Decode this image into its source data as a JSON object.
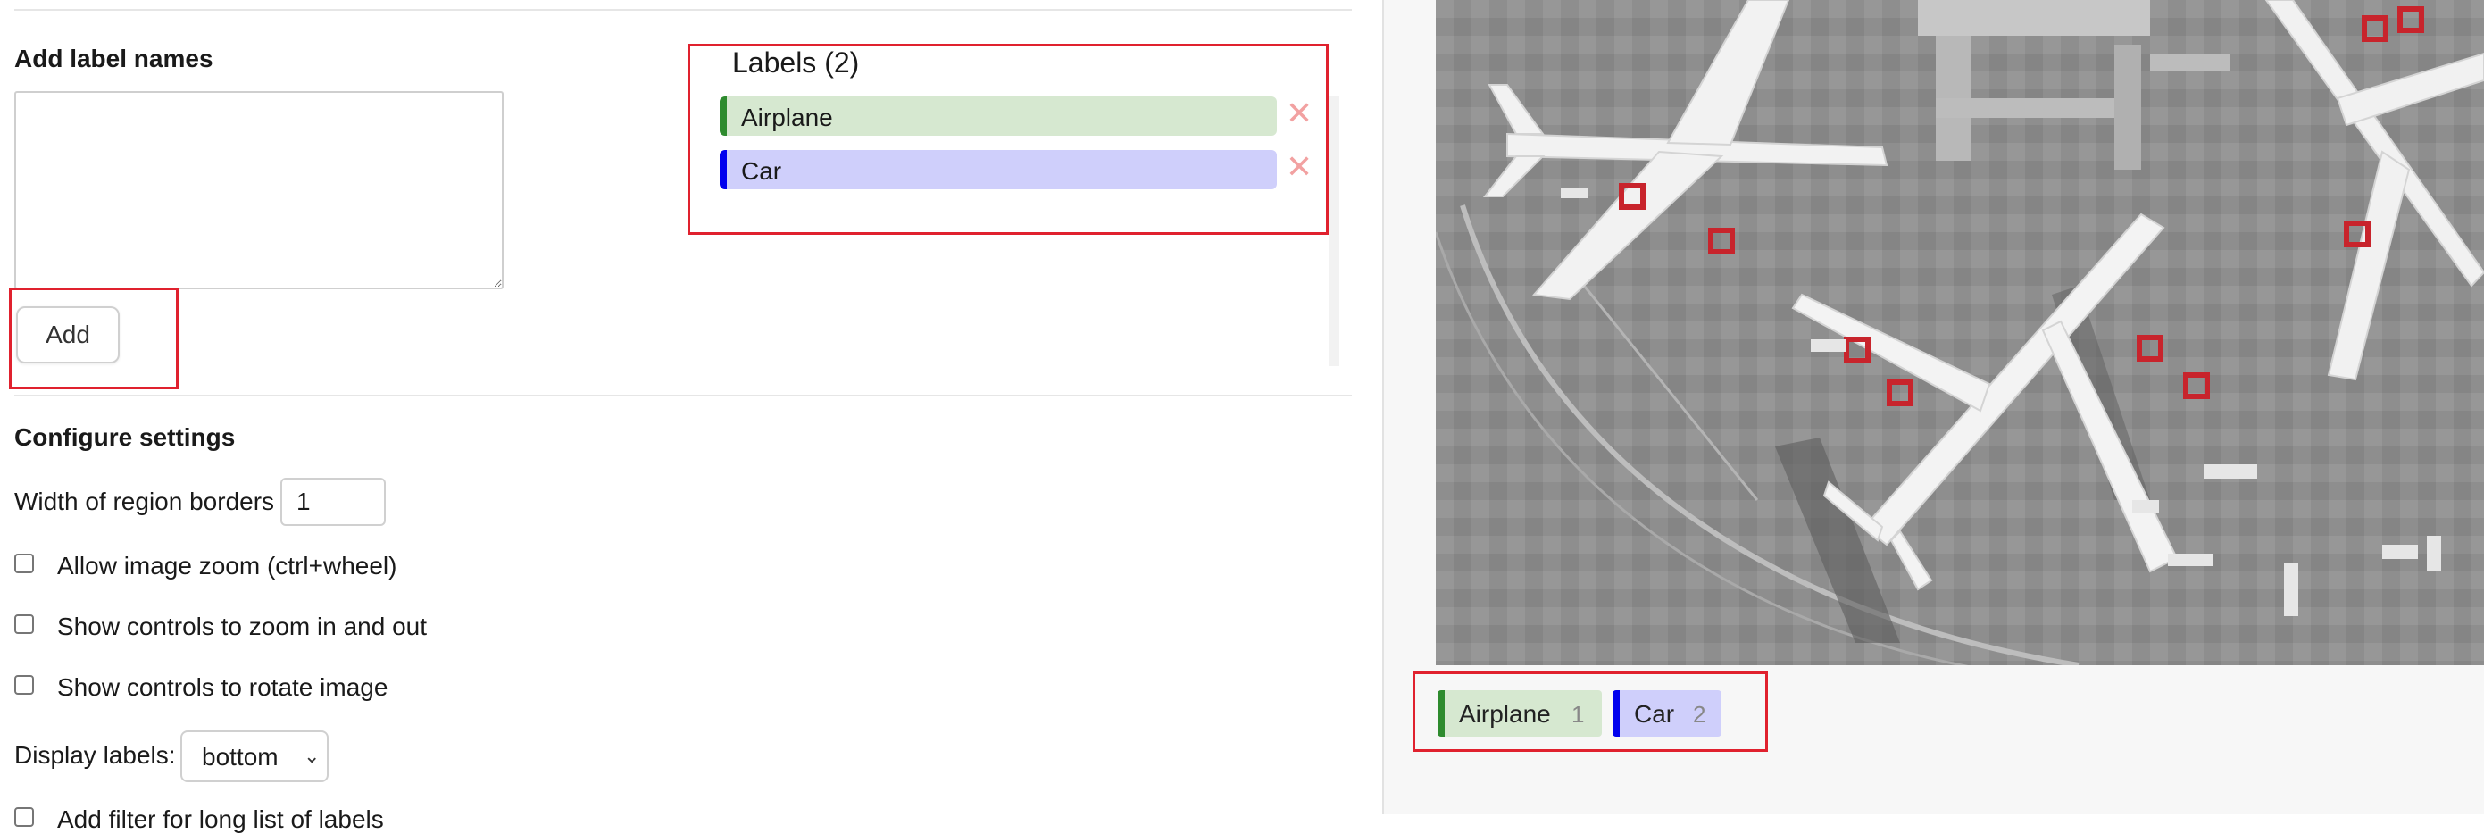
{
  "add_labels": {
    "title": "Add label names",
    "input_value": "",
    "add_button": "Add"
  },
  "labels_panel": {
    "title": "Labels (2)",
    "items": [
      {
        "name": "Airplane",
        "color": "#2e8b2e",
        "bg": "#d6e8d0"
      },
      {
        "name": "Car",
        "color": "#0000ee",
        "bg": "#cfcffb"
      }
    ],
    "delete_glyph": "✕"
  },
  "settings": {
    "title": "Configure settings",
    "border_width_label": "Width of region borders",
    "border_width_value": "1",
    "options": [
      {
        "label": "Allow image zoom (ctrl+wheel)",
        "checked": false
      },
      {
        "label": "Show controls to zoom in and out",
        "checked": false
      },
      {
        "label": "Show controls to rotate image",
        "checked": false
      }
    ],
    "display_labels_label": "Display labels:",
    "display_labels_value": "bottom",
    "cut_off_option": "Add filter for long list of labels"
  },
  "preview": {
    "chips": [
      {
        "name": "Airplane",
        "count": "1",
        "color": "#2e8b2e",
        "bg": "#d6e8d0"
      },
      {
        "name": "Car",
        "count": "2",
        "color": "#0000ee",
        "bg": "#cfcffb"
      }
    ]
  }
}
